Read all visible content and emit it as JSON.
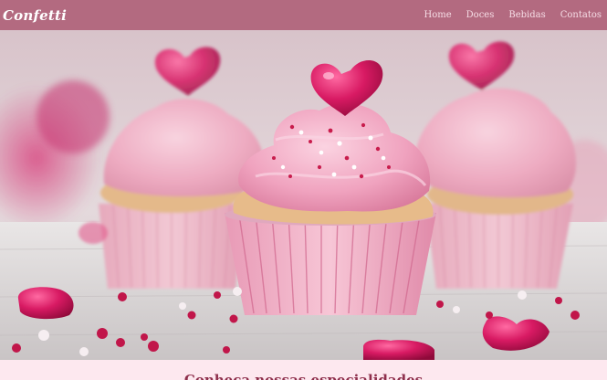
{
  "navbar": {
    "brand": "Confetti",
    "links": [
      {
        "label": "Home"
      },
      {
        "label": "Doces"
      },
      {
        "label": "Bebidas"
      },
      {
        "label": "Contatos"
      }
    ]
  },
  "hero": {
    "image_subject": "pink-frosted-cupcakes-with-heart-toppers"
  },
  "section": {
    "title": "Conheça nossas especialidades"
  },
  "colors": {
    "navbar_bg": "#b36a80",
    "accent": "#8e2f4c",
    "page_bg": "#fbe6ee"
  }
}
